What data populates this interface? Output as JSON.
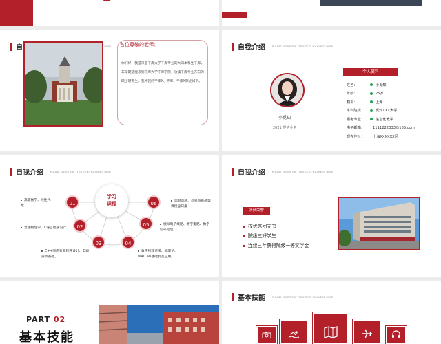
{
  "slides": {
    "intro1": {
      "title": "自我介绍",
      "subtitle": "PLEASE ENTER THE TITLE TEXT YOU NEED HERE",
      "greeting_title": "各位尊敬的老师：",
      "greeting_text": "你们好！我是来自千库大学千库专业的大四本科生千库，非常期望能来到千库大学千库学院，攻读千库专业方向的硕士研究生。我将我的千库X、千库、千库X陈述如下。"
    },
    "intro2": {
      "title": "自我介绍",
      "subtitle": "PLEASE ENTER THE TITLE TEXT YOU NEED HERE",
      "name": "小觅知",
      "graduate": "2021 界毕业生",
      "info_header": "个人资料",
      "info": [
        {
          "label": "姓名：",
          "value": "小觅知",
          "dot": true
        },
        {
          "label": "年龄：",
          "value": "25岁",
          "dot": true
        },
        {
          "label": "籍贯：",
          "value": "上海",
          "dot": true
        },
        {
          "label": "本科院校",
          "value": "觅知XXX大学",
          "dot": true
        },
        {
          "label": "报考专业",
          "value": "信息化教学",
          "dot": true
        },
        {
          "label": "电子邮箱：",
          "value": "1111222333@163.com",
          "dot": false
        },
        {
          "label": "现在住址：",
          "value": "上海XXXXXX区",
          "dot": false
        }
      ]
    },
    "intro3": {
      "title": "自我介绍",
      "subtitle": "PLEASE ENTER THE TITLE TEXT YOU NEED HERE",
      "hub_line1": "学习",
      "hub_line2": "课程",
      "nodes": [
        "01",
        "02",
        "03",
        "04",
        "05",
        "06"
      ],
      "courses": [
        "高等数学、线性代数",
        "普通物理学、C语言程序设计",
        "C++面向对象程序设计、电路分析基础。",
        "数字物理方法、概率论、MATLAB基础及其应用。",
        "模拟电子线路、数字电路、数字信号处理。",
        "高频电路、信号与系统等课程@日度"
      ]
    },
    "intro4": {
      "title": "自我介绍",
      "subtitle": "PLEASE ENTER THE TITLE TEXT YOU NEED HERE",
      "award_header": "所获荣誉",
      "awards": [
        "校优秀团支书",
        "院级三好学生",
        "连续三年获得院级一等奖学金"
      ]
    },
    "part2": {
      "part_label": "PART",
      "part_number": "02",
      "heading": "基本技能"
    },
    "skills": {
      "title": "基本技能",
      "subtitle": "PLEASE ENTER THE TITLE TEXT YOU NEED HERE",
      "icons": [
        "camera-icon",
        "swimming-icon",
        "map-icon",
        "airplane-icon",
        "headphones-icon"
      ]
    }
  },
  "colors": {
    "accent": "#b3202a",
    "dot": "#2ca35a"
  }
}
